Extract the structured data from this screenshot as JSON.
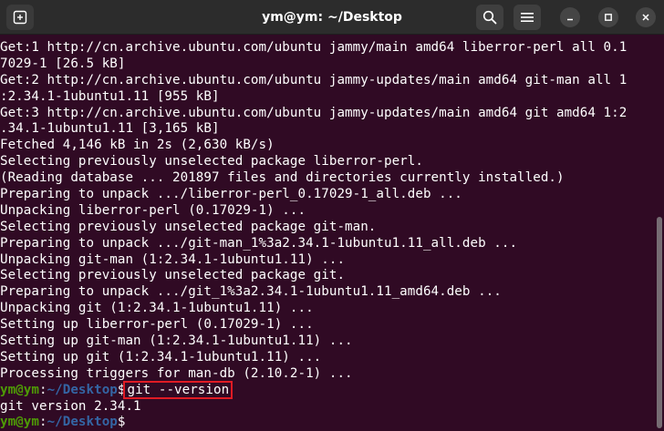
{
  "window": {
    "title": "ym@ym: ~/Desktop"
  },
  "icons": {
    "new_tab": "new-tab-icon",
    "search": "search-icon",
    "menu": "hamburger-menu-icon",
    "minimize": "minimize-icon",
    "maximize": "maximize-icon",
    "close": "close-icon"
  },
  "colors": {
    "background": "#300a24",
    "prompt_user": "#4e9a06",
    "prompt_path": "#3465a4",
    "highlight_box": "#e01b24"
  },
  "terminal": {
    "output_lines": [
      "Get:1 http://cn.archive.ubuntu.com/ubuntu jammy/main amd64 liberror-perl all 0.1",
      "7029-1 [26.5 kB]",
      "Get:2 http://cn.archive.ubuntu.com/ubuntu jammy-updates/main amd64 git-man all 1",
      ":2.34.1-1ubuntu1.11 [955 kB]",
      "Get:3 http://cn.archive.ubuntu.com/ubuntu jammy-updates/main amd64 git amd64 1:2",
      ".34.1-1ubuntu1.11 [3,165 kB]",
      "Fetched 4,146 kB in 2s (2,630 kB/s)",
      "Selecting previously unselected package liberror-perl.",
      "(Reading database ... 201897 files and directories currently installed.)",
      "Preparing to unpack .../liberror-perl_0.17029-1_all.deb ...",
      "Unpacking liberror-perl (0.17029-1) ...",
      "Selecting previously unselected package git-man.",
      "Preparing to unpack .../git-man_1%3a2.34.1-1ubuntu1.11_all.deb ...",
      "Unpacking git-man (1:2.34.1-1ubuntu1.11) ...",
      "Selecting previously unselected package git.",
      "Preparing to unpack .../git_1%3a2.34.1-1ubuntu1.11_amd64.deb ...",
      "Unpacking git (1:2.34.1-1ubuntu1.11) ...",
      "Setting up liberror-perl (0.17029-1) ...",
      "Setting up git-man (1:2.34.1-1ubuntu1.11) ...",
      "Setting up git (1:2.34.1-1ubuntu1.11) ...",
      "Processing triggers for man-db (2.10.2-1) ..."
    ],
    "prompt": {
      "user_host": "ym@ym",
      "separator": ":",
      "path": "~/Desktop",
      "symbol": "$"
    },
    "command": "git --version",
    "command_output": "git version 2.34.1"
  }
}
